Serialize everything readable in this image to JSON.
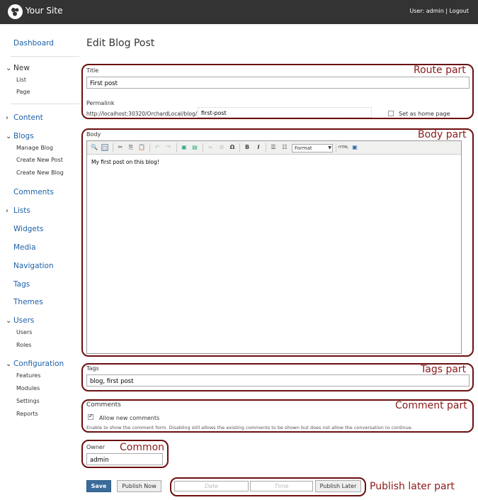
{
  "header": {
    "site_name": "Your Site",
    "user_prefix": "User: ",
    "user_name": "admin",
    "logout": "Logout"
  },
  "sidebar": {
    "dashboard": "Dashboard",
    "new": "New",
    "new_list": "List",
    "new_page": "Page",
    "content": "Content",
    "blogs": "Blogs",
    "manage_blog": "Manage Blog",
    "create_post": "Create New Post",
    "create_blog": "Create New Blog",
    "comments": "Comments",
    "lists": "Lists",
    "widgets": "Widgets",
    "media": "Media",
    "navigation": "Navigation",
    "tags": "Tags",
    "themes": "Themes",
    "users": "Users",
    "users_users": "Users",
    "users_roles": "Roles",
    "configuration": "Configuration",
    "features": "Features",
    "modules": "Modules",
    "settings": "Settings",
    "reports": "Reports"
  },
  "main": {
    "title": "Edit Blog Post",
    "route": {
      "title_label": "Title",
      "title_value": "First post",
      "permalink_label": "Permalink",
      "permalink_prefix": "http://localhost:30320/OrchardLocal/blog/",
      "permalink_value": "first-post",
      "home_label": "Set as home page"
    },
    "body": {
      "label": "Body",
      "format": "Format",
      "content": "My first post on this blog!"
    },
    "tags": {
      "label": "Tags",
      "value": "blog, first post"
    },
    "comments": {
      "label": "Comments",
      "allow": "Allow new comments",
      "help": "Enable to show the comment form. Disabling still allows the existing comments to be shown but does not allow the conversation to continue."
    },
    "owner": {
      "label": "Owner",
      "value": "admin"
    },
    "buttons": {
      "save": "Save",
      "publish_now": "Publish Now",
      "publish_later": "Publish Later",
      "date_placeholder": "Date",
      "time_placeholder": "Time"
    }
  },
  "annotations": {
    "route": "Route part",
    "body": "Body part",
    "tags": "Tags part",
    "comment": "Comment part",
    "common": "Common",
    "publish_later": "Publish later part"
  },
  "colors": {
    "header_bg": "#333333",
    "nav_link": "#1d61a8",
    "annotation": "#8b1a1a",
    "save_button": "#3a6b9b"
  }
}
